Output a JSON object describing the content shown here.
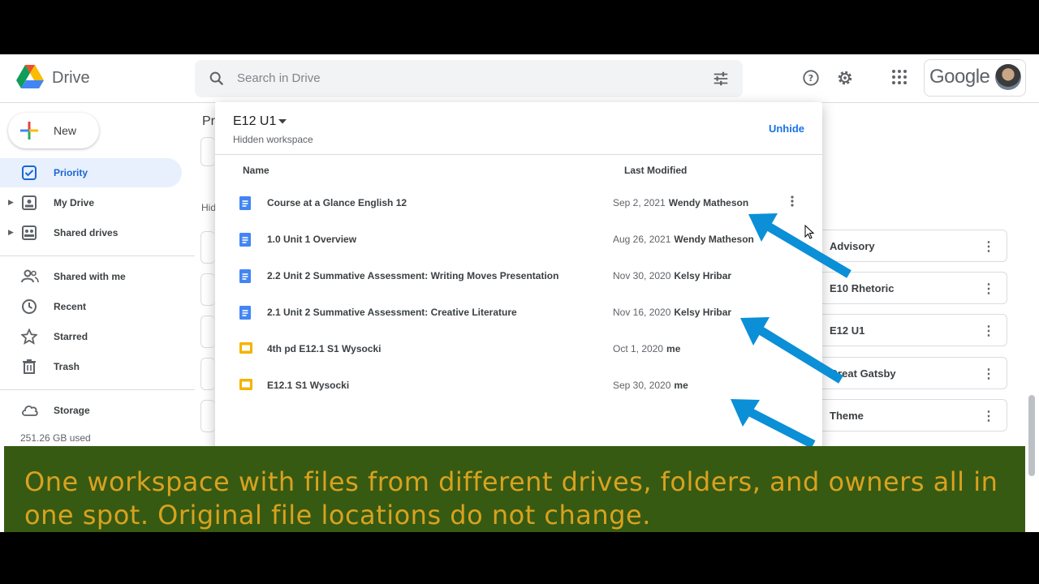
{
  "app": {
    "brand": "Drive",
    "google_wordmark": "Google"
  },
  "search": {
    "placeholder": "Search in Drive"
  },
  "sidebar": {
    "new_label": "New",
    "items": [
      {
        "label": "Priority",
        "icon": "priority-check-icon",
        "active": true
      },
      {
        "label": "My Drive",
        "icon": "my-drive-icon"
      },
      {
        "label": "Shared drives",
        "icon": "shared-drives-icon"
      },
      {
        "label": "Shared with me",
        "icon": "people-icon"
      },
      {
        "label": "Recent",
        "icon": "clock-icon"
      },
      {
        "label": "Starred",
        "icon": "star-icon"
      },
      {
        "label": "Trash",
        "icon": "trash-icon"
      },
      {
        "label": "Storage",
        "icon": "cloud-icon"
      }
    ],
    "storage_used": "251.26 GB used"
  },
  "background": {
    "page_title_partial": "Pr",
    "section_partial": "Hid",
    "workspaces": [
      "Advisory",
      "E10 Rhetoric",
      "E12 U1",
      "Great Gatsby",
      "Theme"
    ]
  },
  "dialog": {
    "title": "E12 U1",
    "subtitle": "Hidden workspace",
    "action": "Unhide",
    "columns": {
      "name": "Name",
      "last_modified": "Last Modified"
    },
    "files": [
      {
        "name": "Course at a Glance English 12",
        "date": "Sep 2, 2021",
        "owner": "Wendy Matheson",
        "type": "doc"
      },
      {
        "name": "1.0 Unit 1 Overview",
        "date": "Aug 26, 2021",
        "owner": "Wendy Matheson",
        "type": "doc"
      },
      {
        "name": "2.2 Unit 2 Summative Assessment: Writing Moves Presentation",
        "date": "Nov 30, 2020",
        "owner": "Kelsy Hribar",
        "type": "doc"
      },
      {
        "name": "2.1 Unit 2 Summative Assessment: Creative Literature",
        "date": "Nov 16, 2020",
        "owner": "Kelsy Hribar",
        "type": "doc"
      },
      {
        "name": "4th pd E12.1 S1 Wysocki",
        "date": "Oct 1, 2020",
        "owner": "me",
        "type": "slides"
      },
      {
        "name": "E12.1 S1 Wysocki",
        "date": "Sep 30, 2020",
        "owner": "me",
        "type": "slides"
      }
    ]
  },
  "caption": {
    "text": "One workspace with files from different drives, folders, and owners all in one spot. Original file locations do not change."
  },
  "colors": {
    "accent": "#1a73e8",
    "arrow": "#0b8fd6",
    "caption_bg": "#375a12",
    "caption_text": "#d9a21f",
    "doc_icon": "#4285f4",
    "slides_icon": "#f4b400"
  }
}
